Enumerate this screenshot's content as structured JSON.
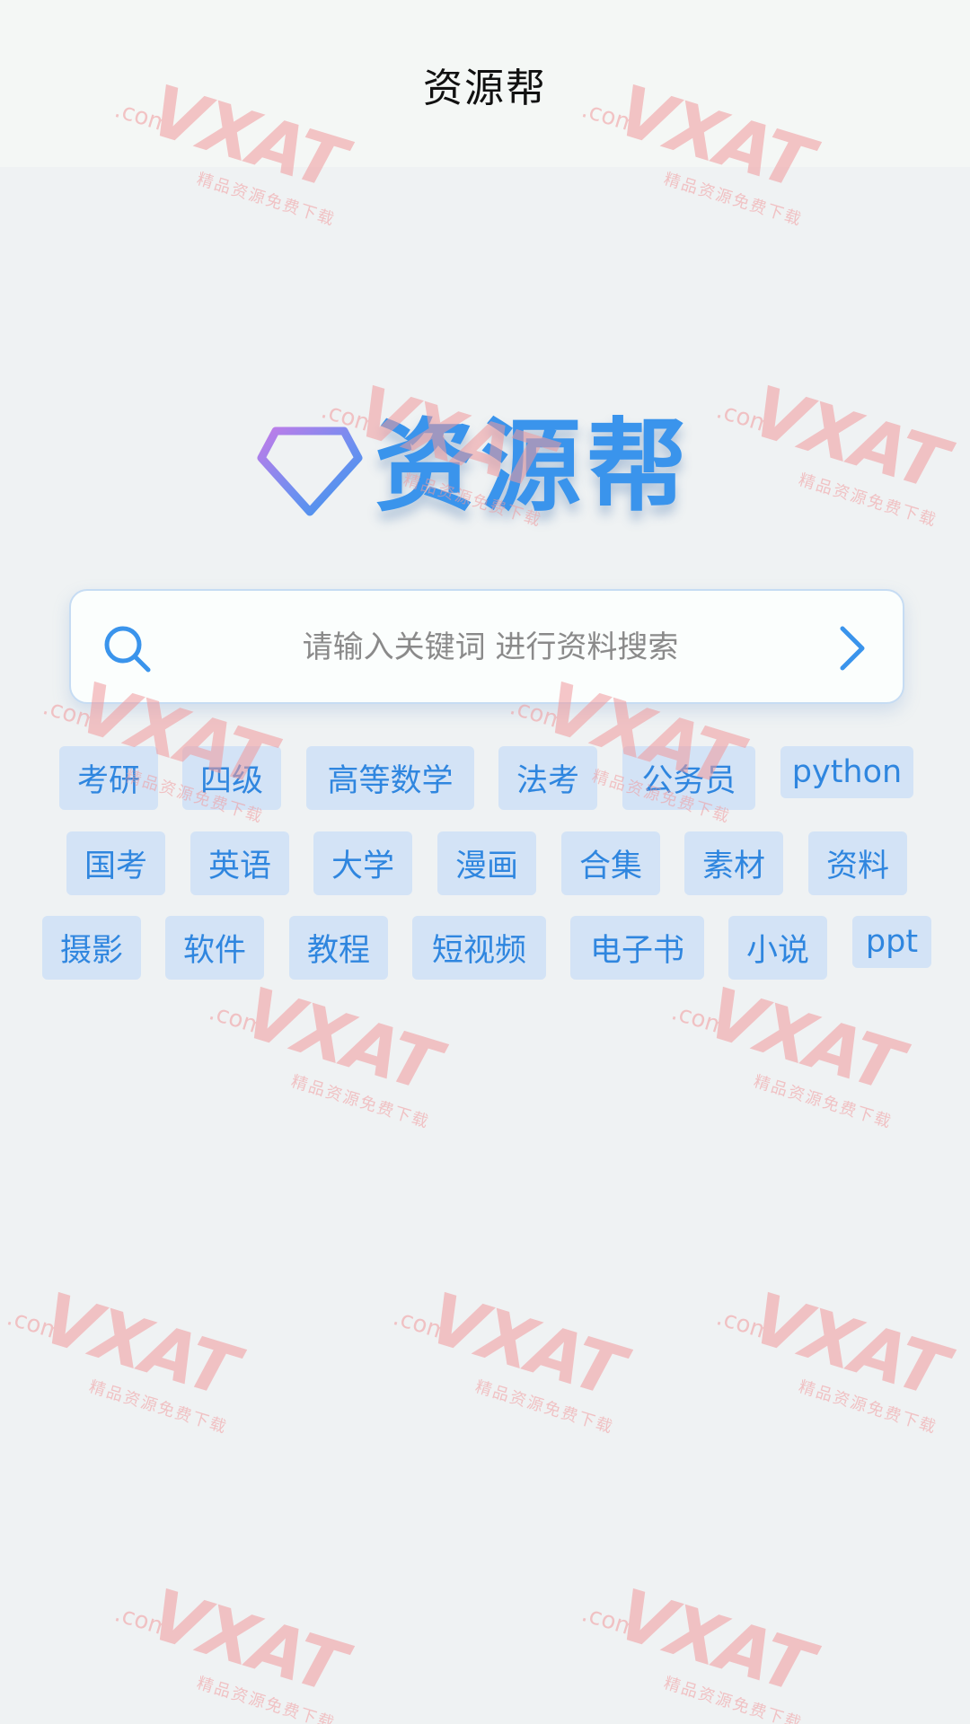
{
  "header": {
    "title": "资源帮"
  },
  "logo": {
    "text": "资源帮",
    "icon": "diamond-icon"
  },
  "search": {
    "placeholder": "请输入关键词 进行资料搜索",
    "value": "",
    "icon": "search-icon",
    "submit_icon": "chevron-right-icon"
  },
  "tags": [
    "考研",
    "四级",
    "高等数学",
    "法考",
    "公务员",
    "python",
    "国考",
    "英语",
    "大学",
    "漫画",
    "合集",
    "素材",
    "资料",
    "摄影",
    "软件",
    "教程",
    "短视频",
    "电子书",
    "小说",
    "ppt"
  ],
  "watermark": {
    "main": "VXAT",
    "com": ".com",
    "sub": "精品资源免费下载"
  },
  "colors": {
    "accent": "#3a94ec",
    "tag_bg": "#d3e3f6",
    "tag_text": "#2f86df",
    "background": "#eff2f3",
    "header_bg": "#f4f7f5",
    "watermark": "#f19a9d"
  }
}
